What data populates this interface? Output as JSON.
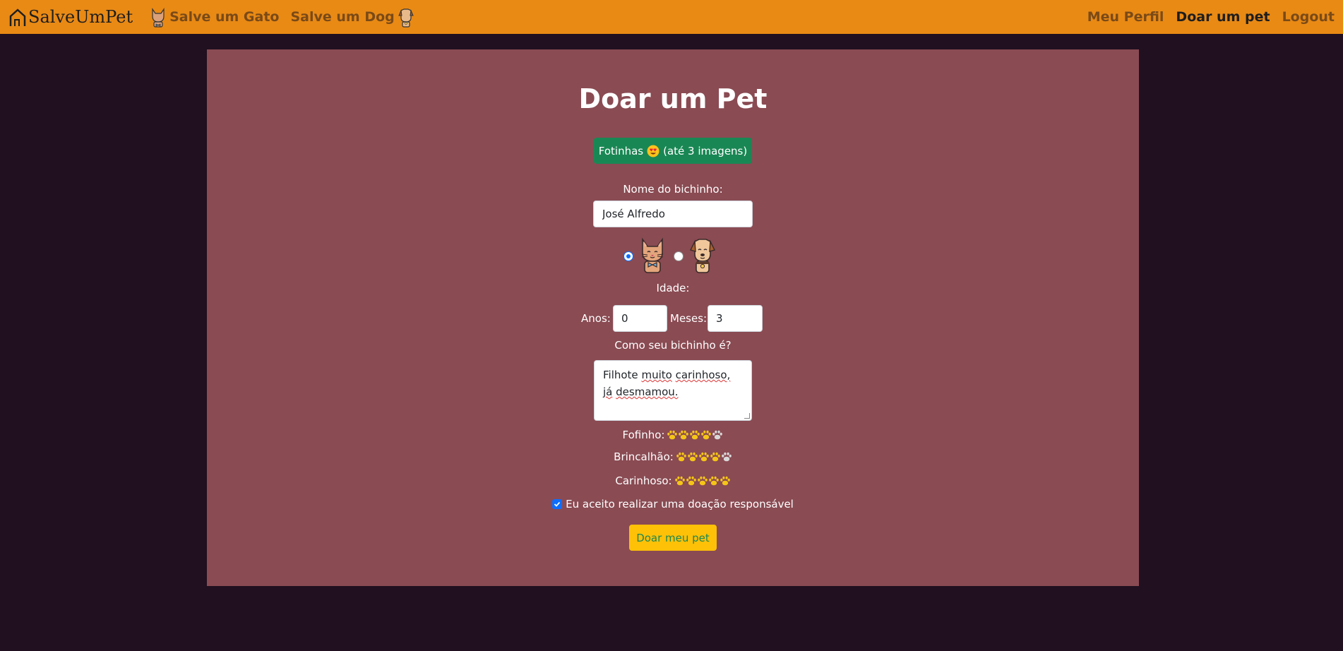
{
  "nav": {
    "brand": "SalveUmPet",
    "links_left": [
      {
        "label": "Salve um Gato",
        "icon": "cat-icon"
      },
      {
        "label": "Salve um Dog",
        "icon": "dog-icon"
      }
    ],
    "links_right": [
      {
        "label": "Meu Perfil",
        "active": false
      },
      {
        "label": "Doar um pet",
        "active": true
      },
      {
        "label": "Logout",
        "active": false
      }
    ]
  },
  "form": {
    "title": "Doar um Pet",
    "photos_button_prefix": "Fotinhas",
    "photos_button_suffix": "(até 3 imagens)",
    "name_label": "Nome do bichinho:",
    "name_value": "José Alfredo",
    "species": {
      "selected": "cat",
      "options": [
        "cat",
        "dog"
      ]
    },
    "age_label": "Idade:",
    "years_label": "Anos:",
    "years_value": "0",
    "months_label": "Meses:",
    "months_value": "3",
    "description_label": "Como seu bichinho é?",
    "description_words": [
      "Filhote",
      "muito",
      "carinhoso,",
      "já",
      "desmamou."
    ],
    "ratings": [
      {
        "label": "Fofinho:",
        "value": 4,
        "max": 5
      },
      {
        "label": "Brincalhão:",
        "value": 4,
        "max": 5
      },
      {
        "label": "Carinhoso:",
        "value": 5,
        "max": 5
      }
    ],
    "accept_label": "Eu aceito realizar uma doação responsável",
    "accept_checked": true,
    "submit_label": "Doar meu pet"
  },
  "colors": {
    "navbar": "#e98a15",
    "background": "#201020",
    "card": "#8a4b53",
    "photos_button": "#198754",
    "submit_button": "#ffc107",
    "paw_filled": "#f5c518",
    "paw_empty": "#d9d9d9"
  }
}
